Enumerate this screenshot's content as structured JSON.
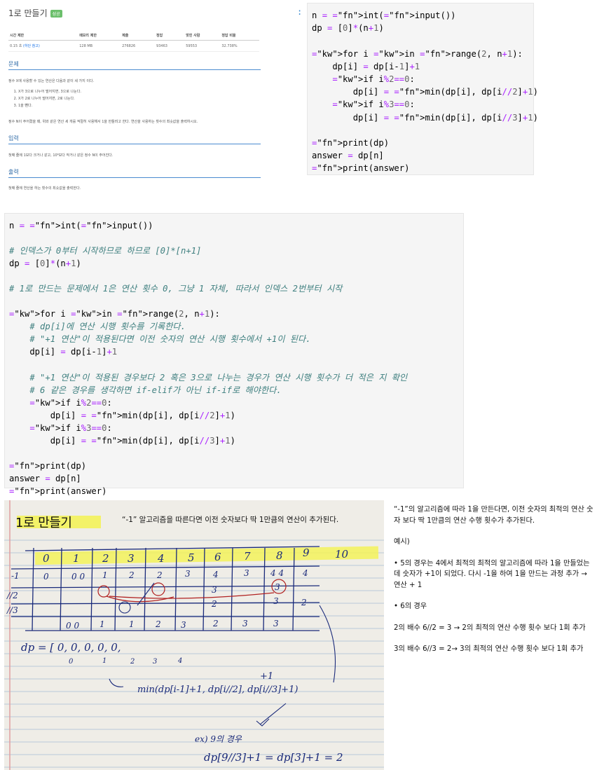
{
  "problem": {
    "title": "1로 만들기",
    "badge": "성공",
    "stats_headers": [
      "시간 제한",
      "메모리 제한",
      "제출",
      "정답",
      "맞힌 사람",
      "정답 비율"
    ],
    "stats_values": [
      "0.15 초",
      "(하단 참고)",
      "128 MB",
      "276826",
      "93463",
      "59553",
      "32.738%"
    ],
    "section_problem": "문제",
    "problem_text": "정수 X에 사용할 수 있는 연산은 다음과 같이 세 가지 이다.",
    "ops": [
      "X가 3으로 나누어 떨어지면, 3으로 나눈다.",
      "X가 2로 나누어 떨어지면, 2로 나눈다.",
      "1을 뺀다."
    ],
    "problem_text2": "정수 N이 주어졌을 때, 위와 같은 연산 세 개를 적절히 사용해서 1을 만들려고 한다. 연산을 사용하는 횟수의 최솟값을 출력하시오.",
    "section_input": "입력",
    "input_text": "첫째 줄에 1보다 크거나 같고, 10⁶보다 작거나 같은 정수 N이 주어진다.",
    "section_output": "출력",
    "output_text": "첫째 줄에 연산을 하는 횟수의 최솟값을 출력한다."
  },
  "code1_lines": [
    "n = int(input())",
    "dp = [0]*(n+1)",
    "",
    "for i in range(2, n+1):",
    "    dp[i] = dp[i-1]+1",
    "    if i%2==0:",
    "        dp[i] = min(dp[i], dp[i//2]+1)",
    "    if i%3==0:",
    "        dp[i] = min(dp[i], dp[i//3]+1)",
    "",
    "print(dp)",
    "answer = dp[n]",
    "print(answer)"
  ],
  "code2_lines": [
    "n = int(input())",
    "",
    "# 인덱스가 0부터 시작하므로 하므로 [0]*[n+1]",
    "dp = [0]*(n+1)",
    "",
    "# 1로 만드는 문제에서 1은 연산 횟수 0, 그냥 1 자체, 따라서 인덱스 2번부터 시작",
    "",
    "for i in range(2, n+1):",
    "    # dp[i]에 연산 시행 횟수를 기록한다.",
    "    # \"+1 연산\"이 적용된다면 이전 숫자의 연산 시행 횟수에서 +1이 된다.",
    "    dp[i] = dp[i-1]+1",
    "",
    "    # \"+1 연산\"이 적용된 경우보다 2 혹은 3으로 나누는 경우가 연산 시행 횟수가 더 적은 지 확인",
    "    # 6 같은 경우를 생각하면 if-elif가 아닌 if-if로 해야한다.",
    "    if i%2==0:",
    "        dp[i] = min(dp[i], dp[i//2]+1)",
    "    if i%3==0:",
    "        dp[i] = min(dp[i], dp[i//3]+1)",
    "",
    "print(dp)",
    "answer = dp[n]",
    "print(answer)"
  ],
  "photo": {
    "title": "1로 만들기",
    "caption": "“-1” 알고리즘을 따른다면 이전 숫자보다 딱 1만큼의 연산이 추가된다.",
    "header_numbers": [
      "0",
      "1",
      "2",
      "3",
      "4",
      "5",
      "6",
      "7",
      "8",
      "9",
      "10"
    ],
    "row_labels": [
      "-1",
      "//2",
      "//3"
    ],
    "dp_label": "dp = [ 0, 0, 0, 0, 0,",
    "dp_idx": [
      "0",
      "1",
      "2",
      "3",
      "4"
    ],
    "min_expr": "min(dp[i-1]+1, dp[i//2], dp[i//3]+1)",
    "plus_one": "+1",
    "ex_label": "ex) 9의 경우",
    "ex_expr": "dp[9//3]+1 = dp[3]+1 = 2"
  },
  "explain": {
    "p1": "“-1”의 알고리즘에 따라 1을 만든다면, 이전 숫자의 최적의 연산 숫자 보다 딱 1만큼의 연산 수행 횟수가 추가된다.",
    "p2": "예시)",
    "p3": "• 5의 경우는 4에서 최적의 최적의 알고리즘에 따라 1을 만들었는데 숫자가 +1이 되었다. 다시 -1을 하여 1을 만드는 과정 추가 → 연산 + 1",
    "p4": "• 6의 경우",
    "p5": "2의 배수 6//2 = 3 → 2의 최적의 연산 수행 횟수 보다 1회 추가",
    "p6": "3의 배수 6//3 = 2→ 3의 최적의 연산 수행 횟수 보다 1회 추가"
  }
}
